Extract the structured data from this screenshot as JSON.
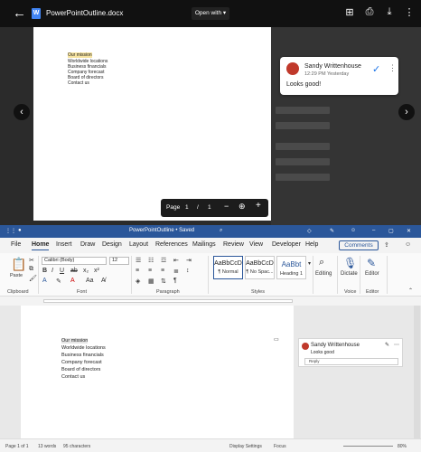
{
  "drive_viewer": {
    "file_name": "PowerPointOutline.docx",
    "open_with_label": "Open with",
    "document_lines": [
      "Our mission",
      "Worldwide locations",
      "Business financials",
      "Company forecast",
      "Board of directors",
      "Contact us"
    ],
    "comment": {
      "author": "Sandy Writtenhouse",
      "time": "12:29 PM Yesterday",
      "body": "Looks good!"
    },
    "page_bar": {
      "label": "Page",
      "current": "1",
      "separator": "/",
      "total": "1"
    }
  },
  "word": {
    "title": "PowerPointOutline • Saved",
    "tabs": [
      "File",
      "Home",
      "Insert",
      "Draw",
      "Design",
      "Layout",
      "References",
      "Mailings",
      "Review",
      "View",
      "Developer",
      "Help"
    ],
    "active_tab": "Home",
    "comments_button": "Comments",
    "font_name": "Calibri (Body)",
    "font_size": "12",
    "styles": [
      {
        "sample": "AaBbCcD",
        "name": "¶ Normal"
      },
      {
        "sample": "AaBbCcD",
        "name": "¶ No Spac..."
      },
      {
        "sample": "AaBbt",
        "name": "Heading 1"
      }
    ],
    "group_labels": {
      "clipboard": "Clipboard",
      "font": "Font",
      "paragraph": "Paragraph",
      "styles": "Styles",
      "voice": "Voice",
      "editor": "Editor"
    },
    "editing_label": "Editing",
    "dictate_label": "Dictate",
    "editor_label": "Editor",
    "paste_label": "Paste",
    "document_lines": [
      "Our mission",
      "Worldwide locations",
      "Business financials",
      "Company forecast",
      "Board of directors",
      "Contact us"
    ],
    "comment": {
      "author": "Sandy Writtenhouse",
      "body": "Looks good",
      "reply_placeholder": "Reply"
    },
    "status": {
      "page": "Page 1 of 1",
      "words": "13 words",
      "chars": "95 characters",
      "display_settings": "Display Settings",
      "focus": "Focus",
      "zoom": "80%"
    }
  }
}
